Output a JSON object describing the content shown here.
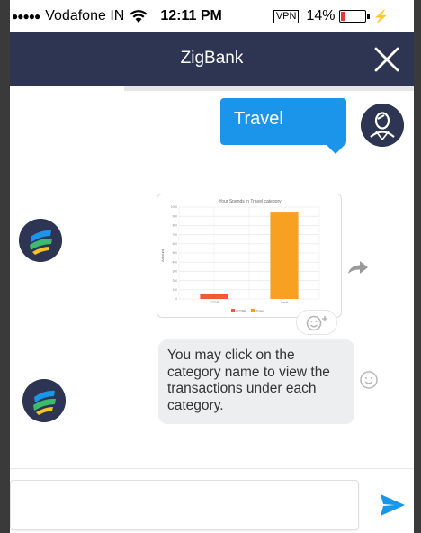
{
  "status_bar": {
    "signal": "●●●●●",
    "carrier": "Vodafone IN",
    "time": "12:11 PM",
    "vpn": "VPN",
    "battery_percent": "14%",
    "battery_level": 0.14
  },
  "header": {
    "title": "ZigBank"
  },
  "messages": {
    "user_message": "Travel",
    "bot_text_lines": [
      "You may click on the",
      "category name to view the",
      "transactions under each",
      "category."
    ]
  },
  "chart_data": {
    "type": "bar",
    "title": "Your Spends in Travel category",
    "ylabel": "Amount",
    "categories": [
      "UTTAR",
      "Travel"
    ],
    "ylim": [
      0,
      1000
    ],
    "yticks": [
      0,
      100,
      200,
      300,
      400,
      500,
      600,
      700,
      800,
      900,
      1000
    ],
    "values": [
      50,
      940
    ],
    "legend": [
      "UTTAR",
      "Travel"
    ],
    "colors": [
      "#f0593a",
      "#f7a021"
    ]
  },
  "composer": {
    "placeholder": ""
  },
  "colors": {
    "header": "#2d3552",
    "user_bubble": "#1b95ea",
    "bot_bubble": "#eceeef",
    "send": "#1b95ea"
  }
}
